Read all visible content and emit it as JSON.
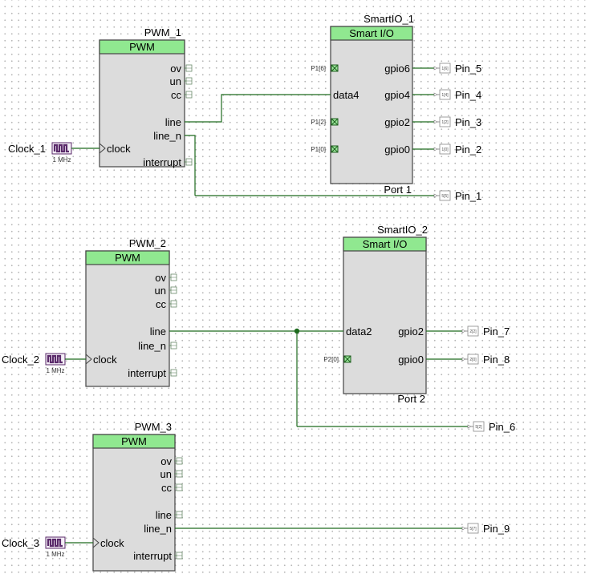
{
  "colors": {
    "header_fill": "#90e890",
    "body_fill": "#dcdcdc",
    "wire": "#1e6b1e",
    "clock_icon": "#5a2a6a"
  },
  "pwm_blocks": [
    {
      "instance": "PWM_1",
      "type": "PWM",
      "pins": [
        "ov",
        "un",
        "cc",
        "line",
        "line_n",
        "clock",
        "interrupt"
      ],
      "clock": {
        "name": "Clock_1",
        "freq": "1 MHz"
      }
    },
    {
      "instance": "PWM_2",
      "type": "PWM",
      "pins": [
        "ov",
        "un",
        "cc",
        "line",
        "line_n",
        "clock",
        "interrupt"
      ],
      "clock": {
        "name": "Clock_2",
        "freq": "1 MHz"
      }
    },
    {
      "instance": "PWM_3",
      "type": "PWM",
      "pins": [
        "ov",
        "un",
        "cc",
        "line",
        "line_n",
        "clock",
        "interrupt"
      ],
      "clock": {
        "name": "Clock_3",
        "freq": "1 MHz"
      }
    }
  ],
  "smartio_blocks": [
    {
      "instance": "SmartIO_1",
      "type": "Smart I/O",
      "port": "Port 1",
      "inputs": [
        {
          "label": "P1[6]",
          "fixed": true
        },
        {
          "label": "data4",
          "fixed": false
        },
        {
          "label": "P1[2]",
          "fixed": true
        },
        {
          "label": "P1[0]",
          "fixed": true
        }
      ],
      "outputs": [
        "gpio6",
        "gpio4",
        "gpio2",
        "gpio0"
      ]
    },
    {
      "instance": "SmartIO_2",
      "type": "Smart I/O",
      "port": "Port 2",
      "inputs": [
        {
          "label": "data2",
          "fixed": false
        },
        {
          "label": "P2[0]",
          "fixed": true
        }
      ],
      "outputs": [
        "gpio2",
        "gpio0"
      ]
    }
  ],
  "pins": [
    {
      "name": "Pin_5",
      "port": "1[6]"
    },
    {
      "name": "Pin_4",
      "port": "1[4]"
    },
    {
      "name": "Pin_3",
      "port": "1[2]"
    },
    {
      "name": "Pin_2",
      "port": "1[0]"
    },
    {
      "name": "Pin_1",
      "port": "5[5]"
    },
    {
      "name": "Pin_7",
      "port": "2[2]"
    },
    {
      "name": "Pin_8",
      "port": "2[0]"
    },
    {
      "name": "Pin_6",
      "port": "5[2]"
    },
    {
      "name": "Pin_9",
      "port": "5[7]"
    }
  ]
}
